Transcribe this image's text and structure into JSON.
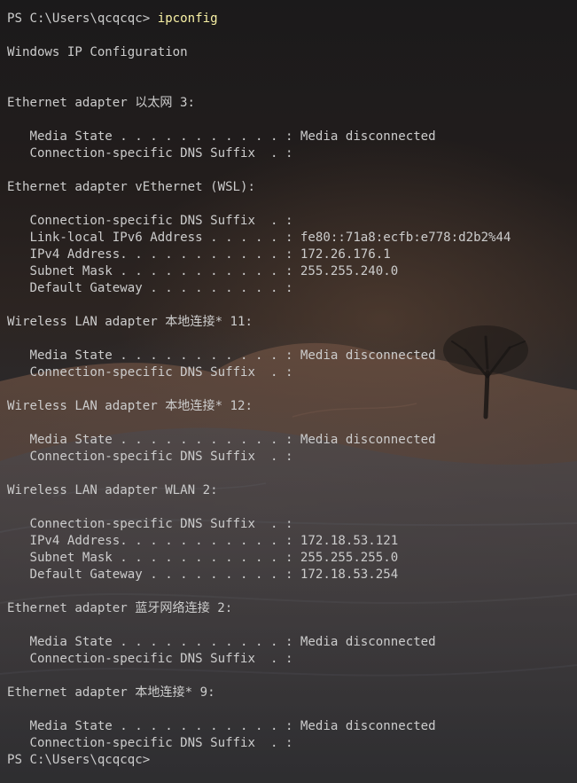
{
  "terminal": {
    "prompt": "PS C:\\Users\\qcqcqc> ",
    "command": "ipconfig",
    "final_prompt": "PS C:\\Users\\qcqcqc>",
    "title_line": "Windows IP Configuration",
    "adapter_lines": [
      "Ethernet adapter 以太网 3:",
      "Ethernet adapter vEthernet (WSL):",
      "Wireless LAN adapter 本地连接* 11:",
      "Wireless LAN adapter 本地连接* 12:",
      "Wireless LAN adapter WLAN 2:",
      "Ethernet adapter 蓝牙网络连接 2:",
      "Ethernet adapter 本地连接* 9:"
    ],
    "rows": {
      "eth3_media_state": "   Media State . . . . . . . . . . . : Media disconnected",
      "eth3_dns_suffix": "   Connection-specific DNS Suffix  . :",
      "wsl_dns_suffix": "   Connection-specific DNS Suffix  . :",
      "wsl_ipv6": "   Link-local IPv6 Address . . . . . : fe80::71a8:ecfb:e778:d2b2%44",
      "wsl_ipv4": "   IPv4 Address. . . . . . . . . . . : 172.26.176.1",
      "wsl_subnet": "   Subnet Mask . . . . . . . . . . . : 255.255.240.0",
      "wsl_gateway": "   Default Gateway . . . . . . . . . :",
      "lan11_media_state": "   Media State . . . . . . . . . . . : Media disconnected",
      "lan11_dns_suffix": "   Connection-specific DNS Suffix  . :",
      "lan12_media_state": "   Media State . . . . . . . . . . . : Media disconnected",
      "lan12_dns_suffix": "   Connection-specific DNS Suffix  . :",
      "wlan2_dns_suffix": "   Connection-specific DNS Suffix  . :",
      "wlan2_ipv4": "   IPv4 Address. . . . . . . . . . . : 172.18.53.121",
      "wlan2_subnet": "   Subnet Mask . . . . . . . . . . . : 255.255.255.0",
      "wlan2_gateway": "   Default Gateway . . . . . . . . . : 172.18.53.254",
      "bt2_media_state": "   Media State . . . . . . . . . . . : Media disconnected",
      "bt2_dns_suffix": "   Connection-specific DNS Suffix  . :",
      "lan9_media_state": "   Media State . . . . . . . . . . . : Media disconnected",
      "lan9_dns_suffix": "   Connection-specific DNS Suffix  . :"
    }
  },
  "colors": {
    "text": "#cccccc",
    "command": "#f9f1a5",
    "background": "#1b1a1b"
  },
  "icons": {
    "background": "desert-landscape-wallpaper"
  }
}
